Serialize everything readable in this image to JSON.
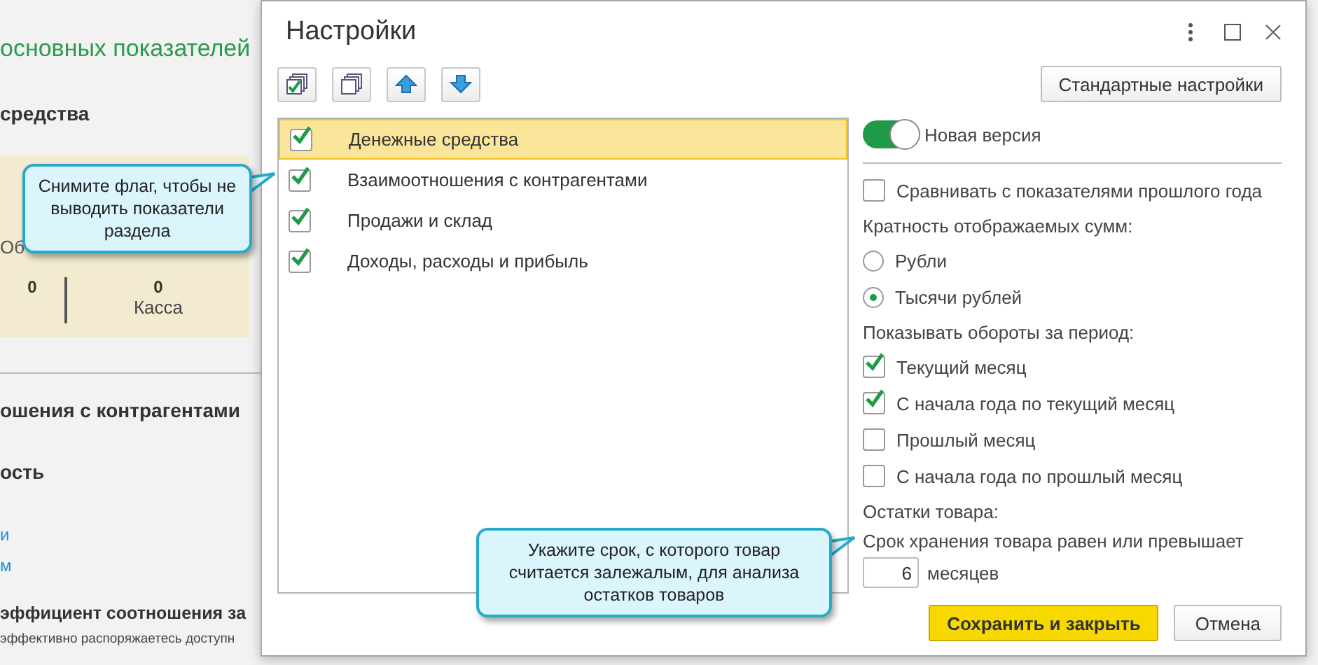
{
  "background": {
    "heading": "основных показателей",
    "section_title": "средства",
    "card": {
      "label": "Об",
      "values": [
        {
          "value": "0"
        },
        {
          "value": "0",
          "label": "Касса"
        }
      ]
    },
    "section2_title": "ошения с контрагентами",
    "subsection_title": "ость",
    "links": [
      "и",
      "м"
    ],
    "indicator_title": "эффициент соотношения за",
    "indicator_text": "эффективно распоряжаетесь доступн"
  },
  "dialog": {
    "title": "Настройки",
    "default_button": "Стандартные настройки",
    "sections": [
      {
        "label": "Денежные средства",
        "checked": true,
        "selected": true
      },
      {
        "label": "Взаимоотношения с контрагентами",
        "checked": true,
        "selected": false
      },
      {
        "label": "Продажи и склад",
        "checked": true,
        "selected": false
      },
      {
        "label": "Доходы, расходы и прибыль",
        "checked": true,
        "selected": false
      }
    ],
    "settings": [
      {
        "kind": "toggle",
        "label": "Новая версия",
        "on": true
      },
      {
        "kind": "checkbox",
        "label": "Сравнивать с показателями прошлого года",
        "checked": false
      },
      {
        "kind": "label",
        "label": "Кратность отображаемых сумм:"
      },
      {
        "kind": "radio",
        "label": "Рубли",
        "selected": false
      },
      {
        "kind": "radio",
        "label": "Тысячи рублей",
        "selected": true
      },
      {
        "kind": "label",
        "label": "Показывать обороты за период:"
      },
      {
        "kind": "checkbox",
        "label": "Текущий месяц",
        "checked": true
      },
      {
        "kind": "checkbox",
        "label": "С начала года по текущий месяц",
        "checked": true
      },
      {
        "kind": "checkbox",
        "label": "Прошлый месяц",
        "checked": false
      },
      {
        "kind": "checkbox",
        "label": "С начала года по прошлый месяц",
        "checked": false
      },
      {
        "kind": "label",
        "label": "Остатки товара:"
      },
      {
        "kind": "label",
        "label": "Срок хранения товара равен или превышает"
      },
      {
        "kind": "number",
        "value": "6",
        "unit": "месяцев"
      }
    ],
    "buttons": [
      {
        "label": "Сохранить и закрыть",
        "primary": true
      },
      {
        "label": "Отмена",
        "primary": false
      }
    ]
  },
  "callouts": [
    {
      "text": "Снимите флаг, чтобы не выводить показатели раздела"
    },
    {
      "text": "Укажите срок, с которого товар считается залежалым, для анализа остатков товаров"
    }
  ]
}
